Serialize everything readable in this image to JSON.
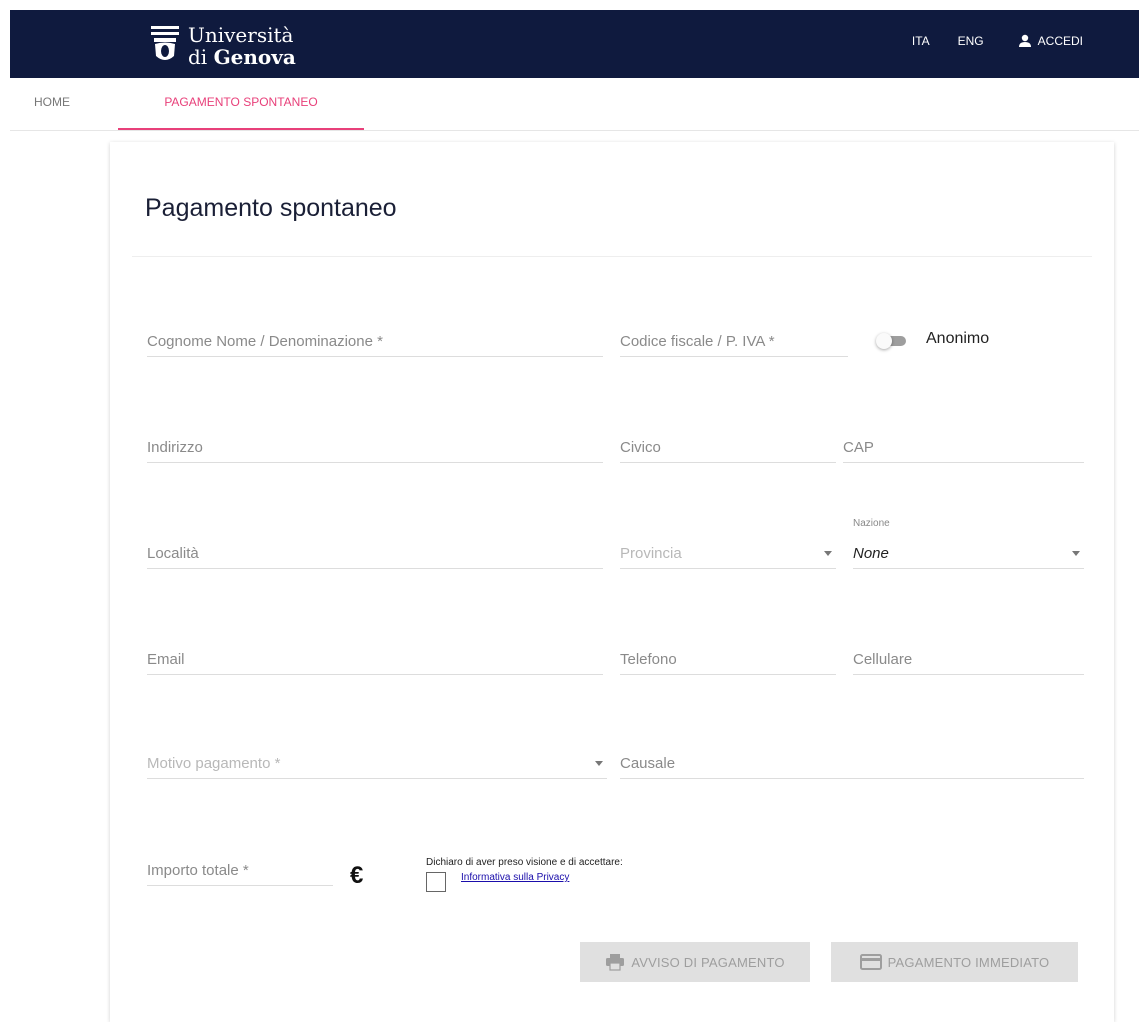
{
  "header": {
    "logo_line1": "Università",
    "logo_line2_prefix": "di ",
    "logo_line2_bold": "Genova",
    "lang_ita": "ITA",
    "lang_eng": "ENG",
    "login_label": "ACCEDI",
    "bg_color": "#0f1a3e"
  },
  "tabs": {
    "home": "HOME",
    "active": "PAGAMENTO SPONTANEO",
    "accent_color": "#e8407a"
  },
  "form": {
    "title": "Pagamento spontaneo",
    "nome": "Cognome Nome / Denominazione *",
    "codice_fiscale": "Codice fiscale / P. IVA *",
    "anonimo": "Anonimo",
    "indirizzo": "Indirizzo",
    "civico": "Civico",
    "cap": "CAP",
    "localita": "Località",
    "provincia": "Provincia",
    "nazione_label": "Nazione",
    "nazione_value": "None",
    "email": "Email",
    "telefono": "Telefono",
    "cellulare": "Cellulare",
    "motivo": "Motivo pagamento *",
    "causale": "Causale",
    "importo": "Importo totale *",
    "currency": "€",
    "privacy_text": "Dichiaro di aver preso visione e di accettare:",
    "privacy_link": "Informativa sulla Privacy",
    "btn_avviso": "AVVISO DI PAGAMENTO",
    "btn_pagamento": "PAGAMENTO IMMEDIATO"
  }
}
